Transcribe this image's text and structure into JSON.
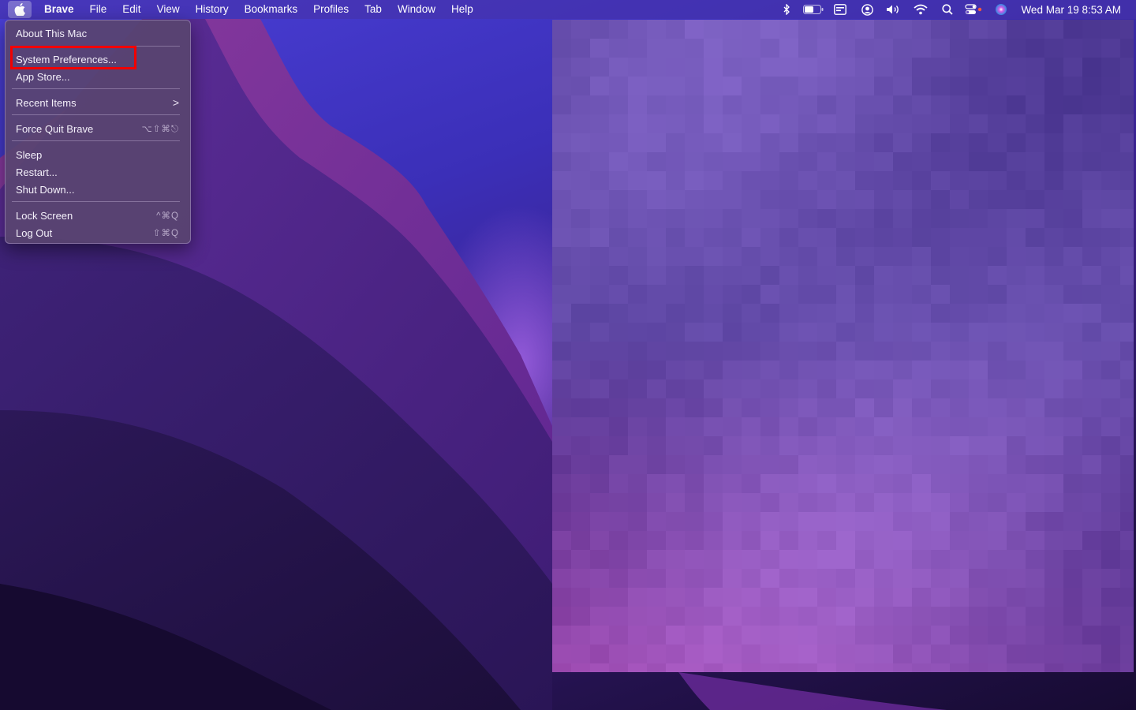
{
  "menubar": {
    "app_name": "Brave",
    "menus": [
      "File",
      "Edit",
      "View",
      "History",
      "Bookmarks",
      "Profiles",
      "Tab",
      "Window",
      "Help"
    ],
    "status_icons": [
      "bluetooth-icon",
      "battery-icon",
      "keyboard-input-icon",
      "user-account-icon",
      "volume-icon",
      "wifi-icon",
      "spotlight-search-icon",
      "control-center-icon",
      "siri-icon"
    ],
    "clock": "Wed Mar 19  8:53 AM"
  },
  "apple_menu": {
    "about": "About This Mac",
    "system_preferences": "System Preferences...",
    "app_store": "App Store...",
    "recent_items": "Recent Items",
    "recent_items_arrow": ">",
    "force_quit": "Force Quit Brave",
    "force_quit_shortcut": "⌥⇧⌘⎋",
    "sleep": "Sleep",
    "restart": "Restart...",
    "shut_down": "Shut Down...",
    "lock_screen": "Lock Screen",
    "lock_screen_shortcut": "^⌘Q",
    "log_out": "Log Out",
    "log_out_shortcut": "⇧⌘Q"
  },
  "colors": {
    "highlight_box": "#f20000",
    "menubar_text": "#ffffff"
  }
}
